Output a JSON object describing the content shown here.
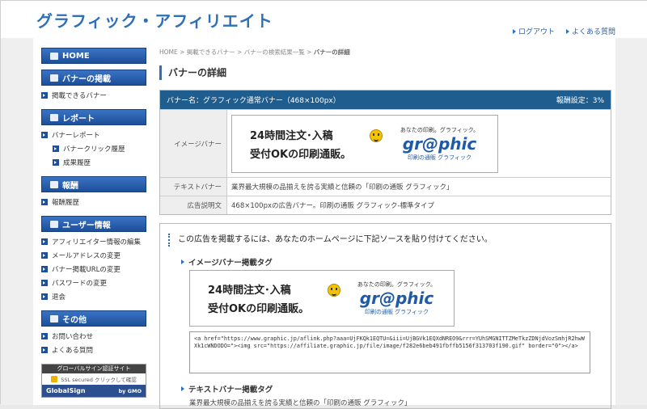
{
  "header": {
    "logo": "グラフィック・アフィリエイト",
    "nav": [
      {
        "label": "ログアウト"
      },
      {
        "label": "よくある質問"
      }
    ]
  },
  "sidebar": {
    "home": "HOME",
    "sections": [
      {
        "title": "バナーの掲載",
        "items": [
          {
            "label": "掲載できるバナー",
            "sub": false
          }
        ]
      },
      {
        "title": "レポート",
        "items": [
          {
            "label": "バナーレポート",
            "sub": false
          },
          {
            "label": "バナークリック履歴",
            "sub": true
          },
          {
            "label": "成果履歴",
            "sub": true
          }
        ]
      },
      {
        "title": "報酬",
        "items": [
          {
            "label": "報酬履歴",
            "sub": false
          }
        ]
      },
      {
        "title": "ユーザー情報",
        "items": [
          {
            "label": "アフィリエイター情報の編集",
            "sub": false
          },
          {
            "label": "メールアドレスの変更",
            "sub": false
          },
          {
            "label": "バナー掲載URLの変更",
            "sub": false
          },
          {
            "label": "パスワードの変更",
            "sub": false
          },
          {
            "label": "退会",
            "sub": false
          }
        ]
      },
      {
        "title": "その他",
        "items": [
          {
            "label": "お問い合わせ",
            "sub": false
          },
          {
            "label": "よくある質問",
            "sub": false
          }
        ]
      }
    ],
    "globalsign": {
      "top": "グローバルサイン認証サイト",
      "mid": "SSL secured クリックして確認",
      "brand": "GlobalSign",
      "by": "by GMO"
    }
  },
  "breadcrumb": {
    "parts": "HOME > 掲載できるバナー > バナーの検索結果一覧 > ",
    "current": "バナーの詳細"
  },
  "page_title": "バナーの詳細",
  "detail": {
    "banner_name": "バナー名：グラフィック通常バナー（468×100px）",
    "reward": "報酬設定：3%",
    "rows": {
      "image_label": "イメージバナー",
      "text_label": "テキストバナー",
      "text_value": "業界最大規模の品揃えを誇る実績と信頼の「印刷の通販 グラフィック」",
      "desc_label": "広告説明文",
      "desc_value": "468×100pxの広告バナー。印刷の通販 グラフィック-標準タイプ"
    }
  },
  "banner": {
    "line1": "24時間注文･入稿",
    "line2": "受付OKの印刷通販。",
    "tagline": "あなたの印刷。グラフィック。",
    "brand": "gr@phic",
    "sub": "印刷の通販 グラフィック"
  },
  "source": {
    "intro": "この広告を掲載するには、あなたのホームページに下記ソースを貼り付けてください。",
    "image_heading": "イメージバナー掲載タグ",
    "code": "<a href=\"https://www.graphic.jp/aflink.php?aaa=UjFKQk1EQTU=&iii=UjBGVk1EQXdNREO9&rrr=YUhSMGNITTZMeTkzZDNjdVozSmhjR2hwWXk1cWNDODO=\"><img src=\"https://affiliate.graphic.jp/file/image/f282e6beb491fbffb5156f313703f190.gif\" border=\"0\"></a>",
    "text_heading": "テキストバナー掲載タグ",
    "text_preview": "業界最大規模の品揃えを誇る実績と信頼の「印刷の通販 グラフィック」"
  }
}
